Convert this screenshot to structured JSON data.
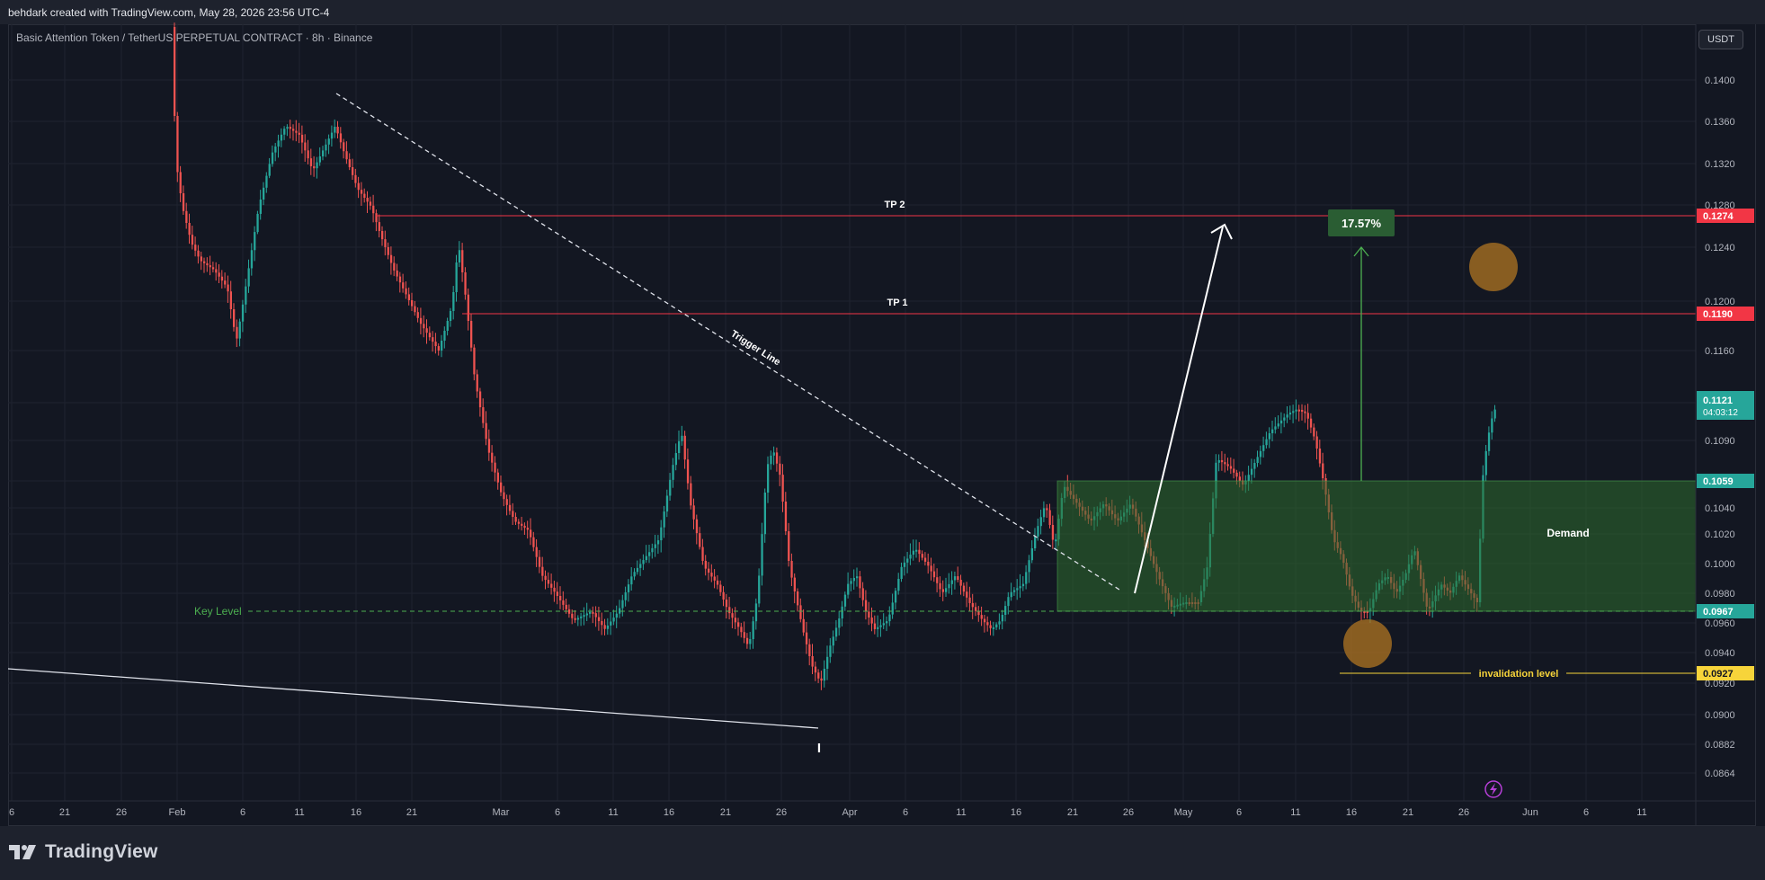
{
  "header": {
    "attribution": "behdark created with TradingView.com, May 28, 2026 23:56 UTC-4"
  },
  "chart": {
    "symbol_title": "Basic Attention Token / TetherUS PERPETUAL CONTRACT · 8h · Binance",
    "currency": "USDT",
    "price_ticks": [
      "0.1400",
      "0.1360",
      "0.1320",
      "0.1280",
      "0.1240",
      "0.1200",
      "0.1160",
      "0.1120",
      "0.1090",
      "0.1060",
      "0.1040",
      "0.1020",
      "0.1000",
      "0.0980",
      "0.0960",
      "0.0940",
      "0.0920",
      "0.0900",
      "0.0882",
      "0.0864"
    ],
    "time_ticks": [
      "6",
      "21",
      "26",
      "Feb",
      "6",
      "11",
      "16",
      "21",
      "Mar",
      "6",
      "11",
      "16",
      "21",
      "26",
      "Apr",
      "6",
      "11",
      "16",
      "21",
      "26",
      "May",
      "6",
      "11",
      "16",
      "21",
      "26",
      "Jun",
      "6",
      "11"
    ],
    "tp2_label": "TP 2",
    "tp2_price": "0.1274",
    "tp1_label": "TP 1",
    "tp1_price": "0.1190",
    "demand_label": "Demand",
    "demand_top_price": "0.1059",
    "key_level_label": "Key Level",
    "key_level_price": "0.0967",
    "invalidation_label": "invalidation level",
    "invalidation_price": "0.0927",
    "current_price": "0.1121",
    "countdown": "04:03:12",
    "trigger_line_label": "Trigger Line",
    "gain_label": "17.57%",
    "wave_marker": "I",
    "colors": {
      "up": "#26a69a",
      "down": "#ef5350",
      "tp_line": "#f23645",
      "demand_fill": "#2e6b2e",
      "invalidation": "#f7d43a",
      "key_level": "#4caf50",
      "highlight": "#b07522"
    }
  },
  "footer": {
    "logo_text": "TradingView"
  }
}
